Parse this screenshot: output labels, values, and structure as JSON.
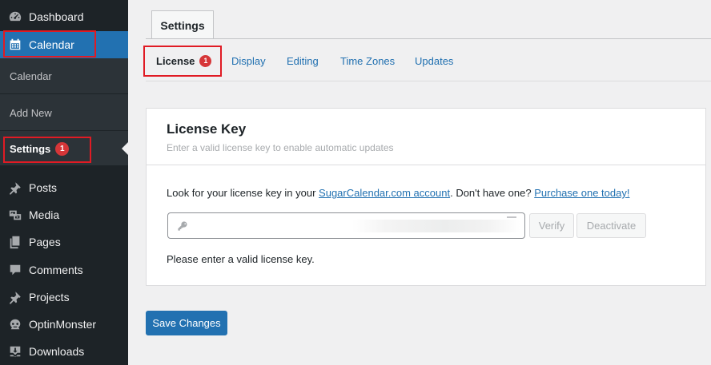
{
  "sidebar": {
    "items": [
      {
        "label": "Dashboard",
        "icon": "dashboard-icon"
      },
      {
        "label": "Calendar",
        "icon": "calendar-icon"
      },
      {
        "label": "Posts",
        "icon": "pin-icon"
      },
      {
        "label": "Media",
        "icon": "media-icon"
      },
      {
        "label": "Pages",
        "icon": "pages-icon"
      },
      {
        "label": "Comments",
        "icon": "comment-icon"
      },
      {
        "label": "Projects",
        "icon": "pin-icon"
      },
      {
        "label": "OptinMonster",
        "icon": "optinmonster-icon"
      },
      {
        "label": "Downloads",
        "icon": "download-icon"
      }
    ],
    "submenu": [
      {
        "label": "Calendar"
      },
      {
        "label": "Add New"
      },
      {
        "label": "Settings",
        "badge": "1"
      }
    ]
  },
  "page": {
    "main_tab": "Settings",
    "subtabs": [
      {
        "label": "License",
        "badge": "1"
      },
      {
        "label": "Display"
      },
      {
        "label": "Editing"
      },
      {
        "label": "Time Zones"
      },
      {
        "label": "Updates"
      }
    ]
  },
  "license": {
    "title": "License Key",
    "description": "Enter a valid license key to enable automatic updates",
    "help_prefix": "Look for your license key in your ",
    "help_link1": "SugarCalendar.com account",
    "help_middle": ". Don't have one? ",
    "help_link2": "Purchase one today!",
    "verify_label": "Verify",
    "deactivate_label": "Deactivate",
    "message": "Please enter a valid license key."
  },
  "footer": {
    "save_label": "Save Changes"
  },
  "colors": {
    "sidebar_bg": "#1d2327",
    "submenu_bg": "#2c3338",
    "accent": "#2271b1",
    "badge": "#d63638",
    "highlight_box": "#e01b24"
  }
}
